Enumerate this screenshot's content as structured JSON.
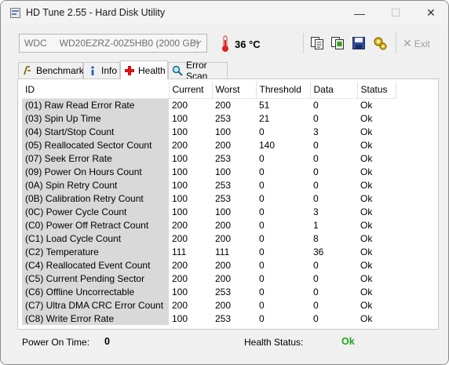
{
  "window": {
    "title": "HD Tune 2.55 - Hard Disk Utility",
    "minimize_glyph": "—",
    "maximize_glyph": "☐",
    "close_glyph": "✕"
  },
  "toolbar": {
    "drive_vendor": "WDC",
    "drive_model": "WD20EZRZ-00Z5HB0 (2000 GB)",
    "temperature": "36 °C",
    "exit_label": "Exit",
    "icons": [
      "copy-info-icon",
      "copy-screenshot-icon",
      "save-icon",
      "options-icon"
    ]
  },
  "tabs": [
    {
      "label": "Benchmark",
      "icon": "benchmark-icon",
      "active": false
    },
    {
      "label": "Info",
      "icon": "info-icon",
      "active": false
    },
    {
      "label": "Health",
      "icon": "health-cross-icon",
      "active": true
    },
    {
      "label": "Error Scan",
      "icon": "magnifier-icon",
      "active": false
    }
  ],
  "health": {
    "columns": [
      "ID",
      "Current",
      "Worst",
      "Threshold",
      "Data",
      "Status"
    ],
    "rows": [
      [
        "(01) Raw Read Error Rate",
        "200",
        "200",
        "51",
        "0",
        "Ok"
      ],
      [
        "(03) Spin Up Time",
        "100",
        "253",
        "21",
        "0",
        "Ok"
      ],
      [
        "(04) Start/Stop Count",
        "100",
        "100",
        "0",
        "3",
        "Ok"
      ],
      [
        "(05) Reallocated Sector Count",
        "200",
        "200",
        "140",
        "0",
        "Ok"
      ],
      [
        "(07) Seek Error Rate",
        "100",
        "253",
        "0",
        "0",
        "Ok"
      ],
      [
        "(09) Power On Hours Count",
        "100",
        "100",
        "0",
        "0",
        "Ok"
      ],
      [
        "(0A) Spin Retry Count",
        "100",
        "253",
        "0",
        "0",
        "Ok"
      ],
      [
        "(0B) Calibration Retry Count",
        "100",
        "253",
        "0",
        "0",
        "Ok"
      ],
      [
        "(0C) Power Cycle Count",
        "100",
        "100",
        "0",
        "3",
        "Ok"
      ],
      [
        "(C0) Power Off Retract Count",
        "200",
        "200",
        "0",
        "1",
        "Ok"
      ],
      [
        "(C1) Load Cycle Count",
        "200",
        "200",
        "0",
        "8",
        "Ok"
      ],
      [
        "(C2) Temperature",
        "111",
        "111",
        "0",
        "36",
        "Ok"
      ],
      [
        "(C4) Reallocated Event Count",
        "200",
        "200",
        "0",
        "0",
        "Ok"
      ],
      [
        "(C5) Current Pending Sector",
        "200",
        "200",
        "0",
        "0",
        "Ok"
      ],
      [
        "(C6) Offline Uncorrectable",
        "100",
        "253",
        "0",
        "0",
        "Ok"
      ],
      [
        "(C7) Ultra DMA CRC Error Count",
        "200",
        "200",
        "0",
        "0",
        "Ok"
      ],
      [
        "(C8) Write Error Rate",
        "100",
        "253",
        "0",
        "0",
        "Ok"
      ]
    ]
  },
  "status": {
    "power_on_time_label": "Power On Time:",
    "power_on_time_value": "0",
    "health_status_label": "Health Status:",
    "health_status_value": "Ok",
    "health_ok_color": "#1ea51e"
  }
}
